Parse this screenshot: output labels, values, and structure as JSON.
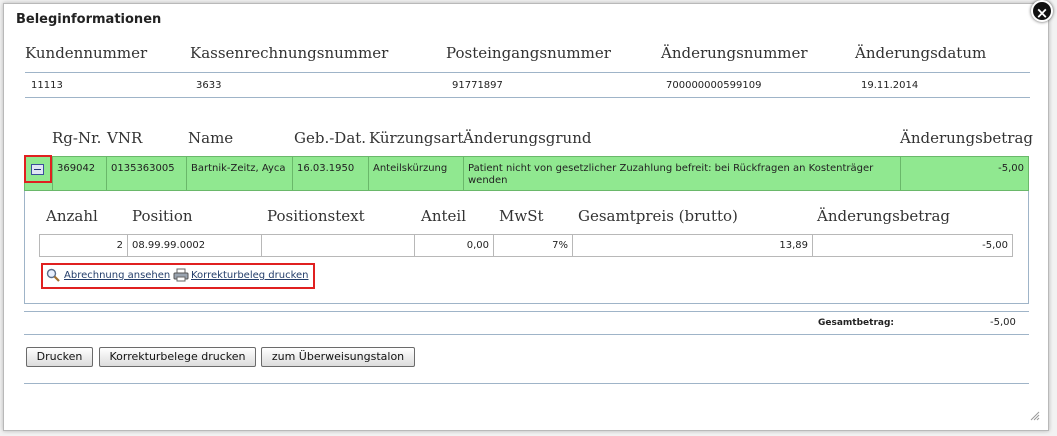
{
  "dialog": {
    "title": "Beleginformationen",
    "close_symbol": "×"
  },
  "header": {
    "columns": [
      "Kundennummer",
      "Kassenrechnungsnummer",
      "Posteingangsnummer",
      "Änderungsnummer",
      "Änderungsdatum"
    ],
    "values": [
      "11113",
      "3633",
      "91771897",
      "700000000599109",
      "19.11.2014"
    ]
  },
  "items": {
    "columns": [
      "Rg-Nr.",
      "VNR",
      "Name",
      "Geb.-Dat.",
      "Kürzungsart",
      "Änderungsgrund",
      "Änderungsbetrag"
    ],
    "row": {
      "rg_nr": "369042",
      "vnr": "0135363005",
      "name": "Bartnik-Zeitz, Ayca",
      "geb_dat": "16.03.1950",
      "kuerzungsart": "Anteilskürzung",
      "aenderungsgrund": "Patient nicht von gesetzlicher Zuzahlung befreit: bei Rückfragen an Kostenträger wenden",
      "aenderungsbetrag": "-5,00"
    }
  },
  "positions": {
    "columns": [
      "Anzahl",
      "Position",
      "Positionstext",
      "Anteil",
      "MwSt",
      "Gesamtpreis (brutto)",
      "Änderungsbetrag"
    ],
    "row": {
      "anzahl": "2",
      "position": "08.99.99.0002",
      "positionstext": "",
      "anteil": "0,00",
      "mwst": "7%",
      "gesamtpreis": "13,89",
      "aenderungsbetrag": "-5,00"
    }
  },
  "actions": {
    "view_billing": "Abrechnung ansehen",
    "print_correction": "Korrekturbeleg drucken"
  },
  "totals": {
    "label": "Gesamtbetrag:",
    "value": "-5,00"
  },
  "buttons": {
    "print": "Drucken",
    "print_corrections": "Korrekturbelege drucken",
    "transfer_slip": "zum Überweisungstalon"
  },
  "icons": {
    "expand": "minus-icon",
    "view": "magnifier-icon",
    "print": "printer-icon",
    "resize": "resize-grip-icon"
  },
  "colors": {
    "row_highlight": "#90e890",
    "annotation_box": "#e02020",
    "link": "#233d6a"
  }
}
